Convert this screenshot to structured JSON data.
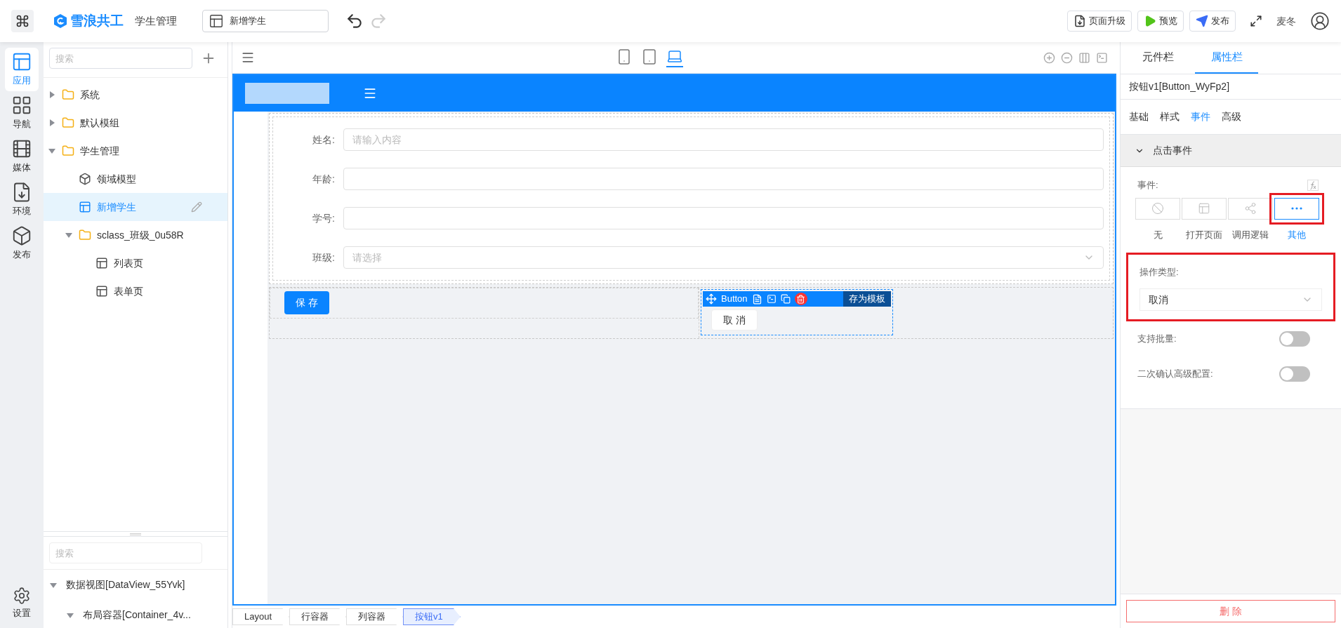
{
  "topbar": {
    "app_name": "雪浪共工",
    "module": "学生管理",
    "page_tab": "新增学生",
    "user": "麦冬",
    "actions": [
      {
        "label": "页面升级",
        "kind": "upgrade"
      },
      {
        "label": "预览",
        "kind": "preview"
      },
      {
        "label": "发布",
        "kind": "publish"
      }
    ]
  },
  "rail": {
    "items": [
      {
        "label": "应用",
        "kind": "app",
        "selected": true
      },
      {
        "label": "导航",
        "kind": "nav",
        "selected": false
      },
      {
        "label": "媒体",
        "kind": "media",
        "selected": false
      },
      {
        "label": "环境",
        "kind": "env",
        "selected": false
      },
      {
        "label": "发布",
        "kind": "publish",
        "selected": false
      }
    ],
    "settings": "设置"
  },
  "tree": {
    "search_placeholder": "搜索",
    "items": [
      {
        "label": "系统",
        "kind": "folder",
        "expanded": false,
        "selected": false
      },
      {
        "label": "默认模组",
        "kind": "folder",
        "expanded": false,
        "selected": false
      },
      {
        "label": "学生管理",
        "kind": "folder",
        "expanded": true,
        "selected": false,
        "children": [
          {
            "label": "领域模型",
            "kind": "model",
            "selected": false
          },
          {
            "label": "新增学生",
            "kind": "page",
            "selected": true
          },
          {
            "label": "sclass_班级_0u58R",
            "kind": "folder",
            "expanded": true,
            "selected": false,
            "children": [
              {
                "label": "列表页",
                "kind": "page",
                "selected": false
              },
              {
                "label": "表单页",
                "kind": "page",
                "selected": false
              }
            ]
          }
        ]
      }
    ]
  },
  "outline": {
    "search_placeholder": "搜索",
    "items": [
      {
        "label": "数据视图[DataView_55Yvk]",
        "expanded": true,
        "children": [
          {
            "label": "布局容器[Container_4v...",
            "expanded": true
          }
        ]
      }
    ]
  },
  "canvas": {
    "devices": [
      {
        "kind": "phone",
        "selected": false
      },
      {
        "kind": "tablet",
        "selected": false
      },
      {
        "kind": "desktop",
        "selected": true
      }
    ],
    "form": [
      {
        "label": "姓名:",
        "kind": "input",
        "placeholder": "请输入内容"
      },
      {
        "label": "年龄:",
        "kind": "input"
      },
      {
        "label": "学号:",
        "kind": "input"
      },
      {
        "label": "班级:",
        "kind": "select",
        "placeholder": "请选择"
      }
    ],
    "primary_button": "保 存",
    "selected_component": {
      "type": "Button",
      "save_template": "存为模板",
      "button": "取 消"
    }
  },
  "breadcrumb": [
    {
      "label": "Layout",
      "selected": false
    },
    {
      "label": "行容器",
      "selected": false
    },
    {
      "label": "列容器",
      "selected": false
    },
    {
      "label": "按钮v1",
      "selected": true
    }
  ],
  "properties": {
    "tabs": [
      {
        "label": "元件栏",
        "selected": false
      },
      {
        "label": "属性栏",
        "selected": true
      }
    ],
    "component": "按钮v1[Button_WyFp2]",
    "subtabs": [
      {
        "label": "基础",
        "selected": false
      },
      {
        "label": "样式",
        "selected": false
      },
      {
        "label": "事件",
        "selected": true
      },
      {
        "label": "高级",
        "selected": false
      }
    ],
    "section": {
      "title": "点击事件",
      "expanded": true
    },
    "event_label": "事件:",
    "events": [
      {
        "label": "无",
        "kind": "none",
        "selected": false,
        "highlighted": false
      },
      {
        "label": "打开页面",
        "kind": "page",
        "selected": false,
        "highlighted": false
      },
      {
        "label": "调用逻辑",
        "kind": "logic",
        "selected": false,
        "highlighted": false
      },
      {
        "label": "其他",
        "kind": "other",
        "selected": true,
        "highlighted": true
      }
    ],
    "operation": {
      "label": "操作类型:",
      "value": "取消",
      "highlighted": true
    },
    "toggles": [
      {
        "label": "支持批量:",
        "on": false
      },
      {
        "label": "二次确认高级配置:",
        "on": false
      }
    ],
    "delete": "删 除"
  }
}
